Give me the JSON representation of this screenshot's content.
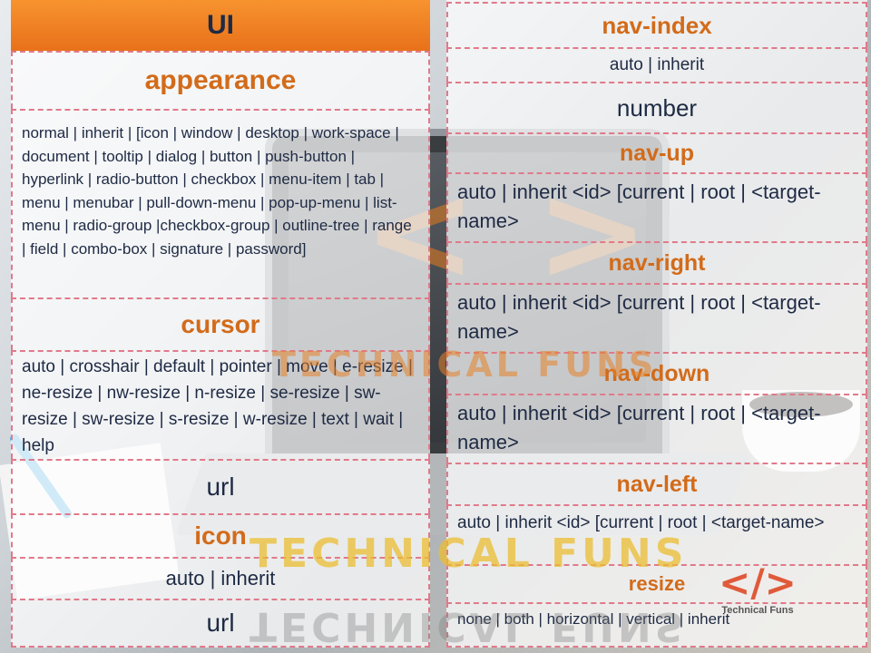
{
  "colors": {
    "header_bg": "#f0811f",
    "title_text": "#d26b1a",
    "body_text": "#1e2a44",
    "grid_line": "#e07a8a"
  },
  "watermark": {
    "main": "TECHNICAL FUNS",
    "lower": "TECHNICAL FUNS",
    "brand_symbol": "</>",
    "brand_text": "Technical Funs"
  },
  "left": {
    "header": "UI",
    "appearance": {
      "title": "appearance",
      "value": "normal | inherit | [icon | window | desktop | work-space | document | tooltip | dialog | button | push-button | hyperlink | radio-button | checkbox | menu-item | tab | menu | menubar | pull-down-menu | pop-up-menu | list-menu | radio-group |checkbox-group | outline-tree | range | field | combo-box | signature | password]"
    },
    "cursor": {
      "title": "cursor",
      "value": "auto | crosshair | default | pointer | move | e-resize | ne-resize | nw-resize | n-resize | se-resize | sw-resize | sw-resize | s-resize | w-resize | text | wait | help",
      "url": "url"
    },
    "icon": {
      "title": "icon",
      "value": "auto | inherit",
      "url": "url"
    }
  },
  "right": {
    "nav_index": {
      "title": "nav-index",
      "value": "auto | inherit",
      "value2": "number"
    },
    "nav_up": {
      "title": "nav-up",
      "value": "auto | inherit <id> [current | root | <target-name>"
    },
    "nav_right": {
      "title": "nav-right",
      "value": "auto | inherit <id> [current | root | <target-name>"
    },
    "nav_down": {
      "title": "nav-down",
      "value": "auto | inherit <id> [current | root | <target-name>"
    },
    "nav_left": {
      "title": "nav-left",
      "value": "auto | inherit <id> [current | root | <target-name>"
    },
    "resize": {
      "title": "resize",
      "value": "none | both | horizontal | vertical | inherit"
    }
  }
}
